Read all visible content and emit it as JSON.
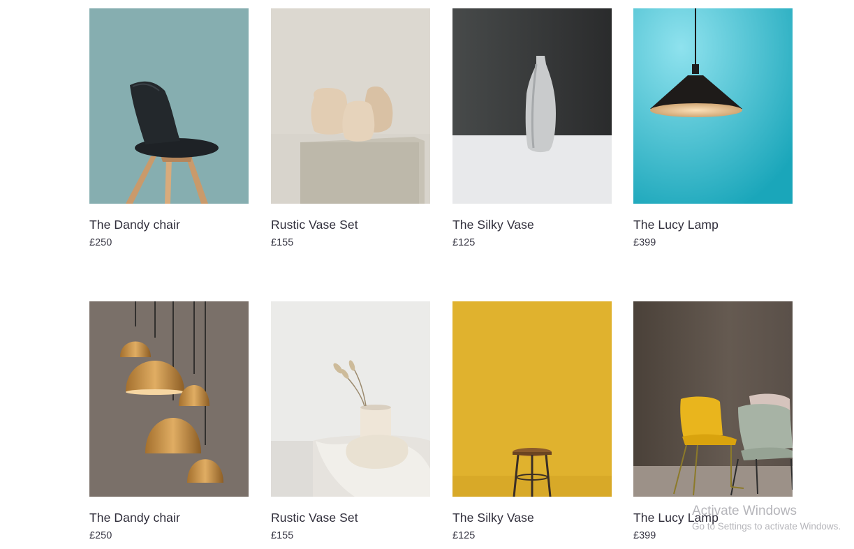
{
  "products": [
    {
      "title": "The Dandy chair",
      "price": "£250",
      "image": "black-chair-on-teal"
    },
    {
      "title": "Rustic Vase Set",
      "price": "£155",
      "image": "clay-vases-on-plinth"
    },
    {
      "title": "The Silky Vase",
      "price": "£125",
      "image": "white-bottle-vase"
    },
    {
      "title": "The Lucy Lamp",
      "price": "£399",
      "image": "black-pendant-lamp-on-cyan"
    },
    {
      "title": "The Dandy chair",
      "price": "£250",
      "image": "copper-pendant-lamps"
    },
    {
      "title": "Rustic Vase Set",
      "price": "£155",
      "image": "white-vase-with-pampas"
    },
    {
      "title": "The Silky Vase",
      "price": "£125",
      "image": "stool-on-yellow"
    },
    {
      "title": "The Lucy Lamp",
      "price": "£399",
      "image": "yellow-and-sage-chairs"
    }
  ],
  "watermark": {
    "title": "Activate Windows",
    "subtitle": "Go to Settings to activate Windows."
  },
  "colors": {
    "teal": "#86aeb0",
    "cyan": "#3bbfd2",
    "mustard": "#e0b22e",
    "text": "#2f2d3a"
  }
}
